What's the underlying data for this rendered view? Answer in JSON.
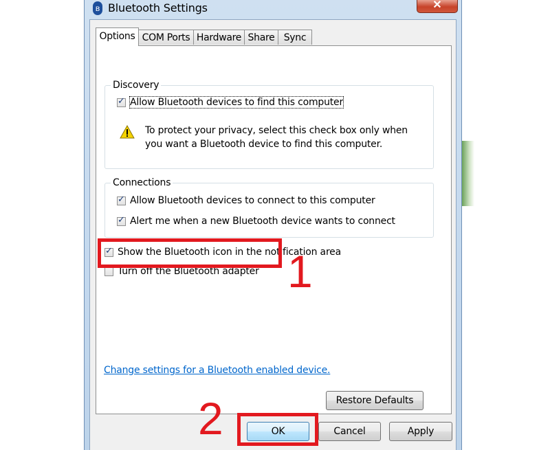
{
  "window": {
    "title": "Bluetooth Settings",
    "close_glyph": "✕"
  },
  "tabs": [
    {
      "label": "Options",
      "active": true
    },
    {
      "label": "COM Ports",
      "active": false
    },
    {
      "label": "Hardware",
      "active": false
    },
    {
      "label": "Share",
      "active": false
    },
    {
      "label": "Sync",
      "active": false
    }
  ],
  "discovery": {
    "title": "Discovery",
    "allow_find": {
      "label": "Allow Bluetooth devices to find this computer",
      "checked": true
    },
    "warning_line1": "To protect your privacy, select this check box only when",
    "warning_line2": "you want a Bluetooth device to find this computer."
  },
  "connections": {
    "title": "Connections",
    "allow_connect": {
      "label": "Allow Bluetooth devices to connect to this computer",
      "checked": true
    },
    "alert_me": {
      "label": "Alert me when a new Bluetooth device wants to connect",
      "checked": true
    }
  },
  "show_icon": {
    "label": "Show the Bluetooth icon in the notification area",
    "checked": true
  },
  "turn_off": {
    "label": "Turn off the Bluetooth adapter",
    "checked": false
  },
  "change_settings_link": "Change settings for a Bluetooth enabled device.",
  "buttons": {
    "restore_defaults": "Restore Defaults",
    "ok": "OK",
    "cancel": "Cancel",
    "apply": "Apply"
  },
  "annotations": {
    "step1": "1",
    "step2": "2",
    "highlight_color": "#e2191f"
  },
  "icons": {
    "title_icon": "bluetooth-icon",
    "warning_icon": "warning-icon"
  },
  "colors": {
    "link": "#0066cc",
    "checkmark": "#1c3d7a",
    "window_frame": "#c3d8ee"
  }
}
